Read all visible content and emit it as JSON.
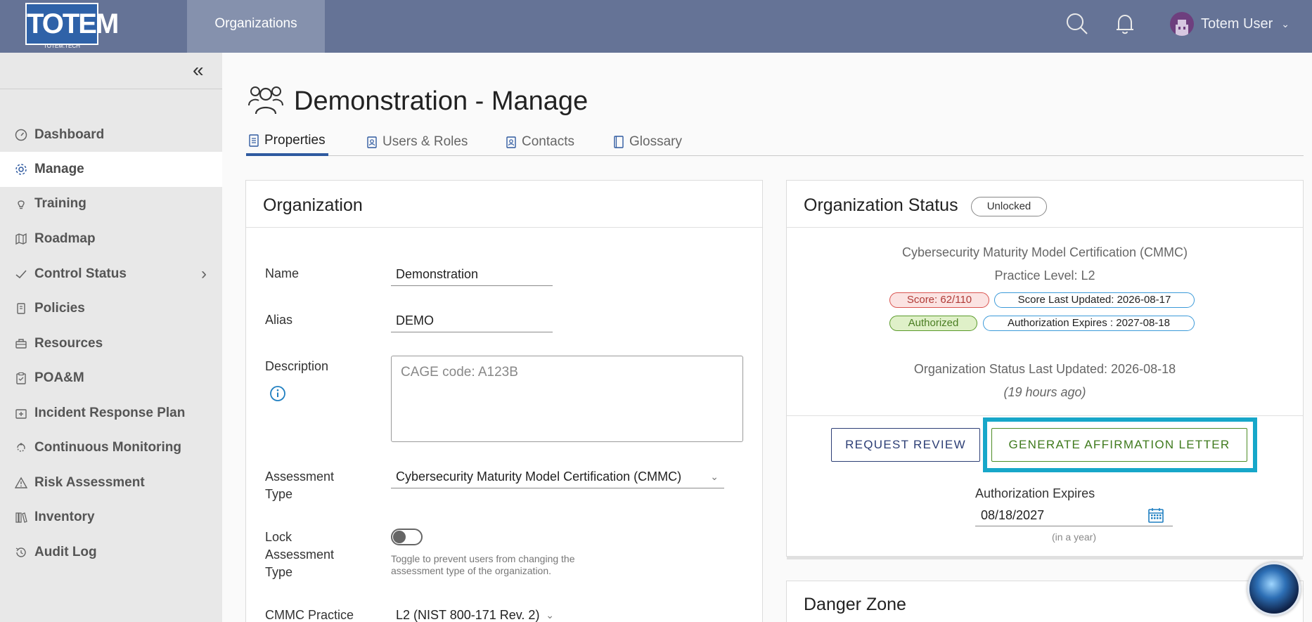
{
  "header": {
    "logo_text": "TOTEM",
    "logo_subtext": "TOTEM.TECH",
    "nav_organizations": "Organizations",
    "user_name": "Totem User"
  },
  "sidebar": {
    "items": [
      {
        "label": "Dashboard",
        "icon": "gauge-icon"
      },
      {
        "label": "Manage",
        "icon": "gear-icon",
        "active": true
      },
      {
        "label": "Training",
        "icon": "lightbulb-icon"
      },
      {
        "label": "Roadmap",
        "icon": "map-icon"
      },
      {
        "label": "Control Status",
        "icon": "check-icon"
      },
      {
        "label": "Policies",
        "icon": "scroll-icon"
      },
      {
        "label": "Resources",
        "icon": "toolbox-icon"
      },
      {
        "label": "POA&M",
        "icon": "clipboard-icon"
      },
      {
        "label": "Incident Response Plan",
        "icon": "first-aid-icon"
      },
      {
        "label": "Continuous Monitoring",
        "icon": "cycle-icon"
      },
      {
        "label": "Risk Assessment",
        "icon": "warning-icon"
      },
      {
        "label": "Inventory",
        "icon": "books-icon"
      },
      {
        "label": "Audit Log",
        "icon": "history-icon"
      }
    ]
  },
  "page": {
    "title": "Demonstration - Manage",
    "tabs": [
      "Properties",
      "Users & Roles",
      "Contacts",
      "Glossary"
    ]
  },
  "organization_card": {
    "title": "Organization",
    "name_label": "Name",
    "name_value": "Demonstration",
    "alias_label": "Alias",
    "alias_value": "DEMO",
    "description_label": "Description",
    "description_value": "CAGE code: A123B",
    "assessment_type_label": "Assessment Type",
    "assessment_type_value": "Cybersecurity Maturity Model Certification (CMMC)",
    "lock_label": "Lock Assessment Type",
    "lock_hint": "Toggle to prevent users from changing the assessment type of the organization.",
    "lock_on": false,
    "practice_label": "CMMC Practice",
    "practice_value": "L2 (NIST 800-171 Rev. 2)"
  },
  "status_card": {
    "title": "Organization Status",
    "lock_badge": "Unlocked",
    "framework": "Cybersecurity Maturity Model Certification (CMMC)",
    "practice_level": "Practice Level: L2",
    "score_badge": "Score: 62/110",
    "score_updated_badge": "Score Last Updated: 2026-08-17",
    "authorized_badge": "Authorized",
    "auth_expires_badge": "Authorization Expires : 2027-08-18",
    "status_updated": "Organization Status Last Updated: 2026-08-18",
    "status_updated_relative": "(19 hours ago)",
    "request_review_button": "REQUEST REVIEW",
    "generate_letter_button": "GENERATE AFFIRMATION LETTER",
    "auth_expires_label": "Authorization Expires",
    "auth_expires_value": "08/18/2027",
    "auth_expires_relative": "(in a year)"
  },
  "danger_card": {
    "title": "Danger Zone"
  },
  "colors": {
    "header_bg": "#657396",
    "nav_active_bg": "#8591ad",
    "sidebar_bg": "#e8e8e8",
    "tab_underline": "#2f5aa0",
    "highlight_border": "#17a7c9",
    "score_red": "#d9534f",
    "authorized_green": "#5a9a2a",
    "badge_blue": "#3b9ad9",
    "generate_green": "#4c8c25"
  }
}
